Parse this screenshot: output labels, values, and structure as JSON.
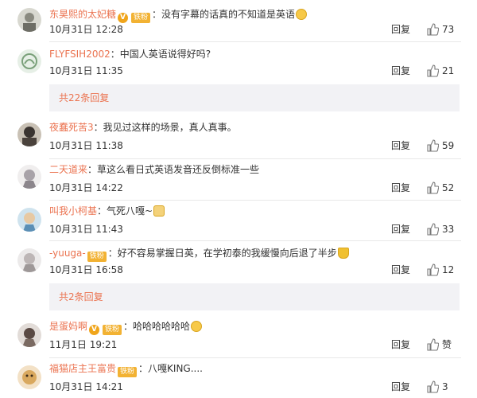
{
  "reply_label": "回复",
  "comments": [
    {
      "username": "东昊熙的太妃糖",
      "has_v": true,
      "badge": "铁粉",
      "text": "没有字幕的话真的不知道是英语",
      "emoji": "smile-emoji",
      "time": "10月31日 12:28",
      "likes": "73"
    },
    {
      "username": "FLYFSIH2002",
      "text": "中国人英语说得好吗?",
      "time": "10月31日 11:35",
      "likes": "21",
      "more_replies": "共22条回复"
    },
    {
      "username": "夜蠢死苦3",
      "text": "我见过这样的场景，真人真事。",
      "time": "10月31日 11:38",
      "likes": "59"
    },
    {
      "username": "二天道来",
      "text": "草这么看日式英语发音还反倒标准一些",
      "time": "10月31日 14:22",
      "likes": "52"
    },
    {
      "username": "叫我小柯基",
      "text": "气死八嘎~",
      "emoji": "dog-emoji",
      "time": "10月31日 11:43",
      "likes": "33"
    },
    {
      "username": "-yuuga-",
      "badge": "铁粉",
      "text": "好不容易掌握日英，在学初泰的我缓慢向后退了半步",
      "emoji": "trophy-emoji",
      "time": "10月31日 16:58",
      "likes": "12",
      "more_replies": "共2条回复"
    },
    {
      "username": "是蛋妈啊",
      "has_v": true,
      "badge": "铁粉",
      "text": "哈哈哈哈哈哈",
      "emoji": "laugh-emoji",
      "time": "11月1日 19:21",
      "likes": "赞"
    },
    {
      "username": "福猫店主王富贵",
      "badge": "铁粉",
      "text": "八嘎KING....",
      "time": "10月31日 14:21",
      "likes": "3"
    }
  ],
  "colors": {
    "username": "#eb7350",
    "more_bg": "#f2f2f5",
    "badge": "#f2b233"
  }
}
